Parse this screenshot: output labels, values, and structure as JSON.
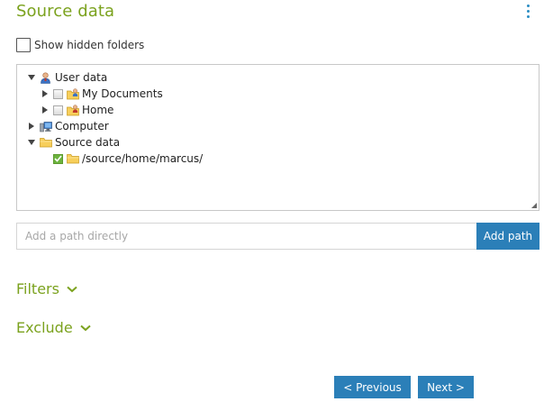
{
  "header": {
    "title": "Source data",
    "menu_icon": "kebab-menu-icon"
  },
  "options": {
    "show_hidden_label": "Show hidden folders",
    "show_hidden_checked": false
  },
  "tree": {
    "nodes": [
      {
        "label": "User data",
        "icon": "user-icon",
        "expanded": true
      },
      {
        "label": "My Documents",
        "icon": "folder-user-icon",
        "expanded": false,
        "checked": false
      },
      {
        "label": "Home",
        "icon": "folder-user-icon",
        "expanded": false,
        "checked": false
      },
      {
        "label": "Computer",
        "icon": "computer-icon",
        "expanded": false
      },
      {
        "label": "Source data",
        "icon": "folder-icon",
        "expanded": true
      },
      {
        "label": "/source/home/marcus/",
        "icon": "folder-icon",
        "checked": true
      }
    ]
  },
  "path_entry": {
    "placeholder": "Add a path directly",
    "value": "",
    "button_label": "Add path"
  },
  "sections": {
    "filters_label": "Filters",
    "exclude_label": "Exclude"
  },
  "navigation": {
    "previous_label": "< Previous",
    "next_label": "Next >"
  },
  "colors": {
    "accent_green": "#7ba21e",
    "button_blue": "#2b7fb8",
    "checked_green": "#6cb33e"
  }
}
